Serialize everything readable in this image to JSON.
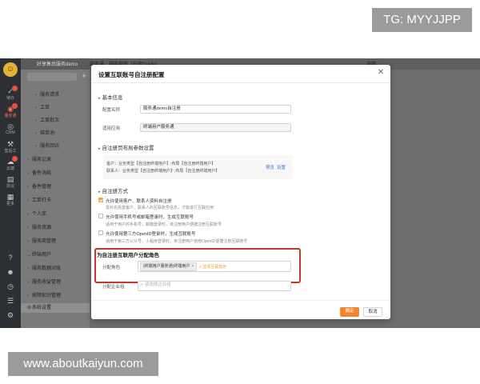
{
  "watermarks": {
    "top": "TG: MYYJJPP",
    "bottom": "www.aboutkaiyun.com"
  },
  "app": {
    "header_title": "好享售后服务demo",
    "tabs": [
      "服务通",
      "服务指南（升级Guide）"
    ],
    "right_label": "全部"
  },
  "rail": {
    "items": [
      {
        "label": "待办",
        "icon": "check-icon"
      },
      {
        "label": "服务通",
        "icon": "service-icon",
        "active": true
      },
      {
        "label": "CRM",
        "icon": "crm-icon"
      },
      {
        "label": "售后工",
        "icon": "wrench-icon"
      },
      {
        "label": "云端",
        "icon": "cloud-icon"
      },
      {
        "label": "协议",
        "icon": "doc-icon"
      },
      {
        "label": "更多",
        "icon": "grid-icon"
      }
    ]
  },
  "tree": {
    "items": [
      {
        "label": "服务请求",
        "sub": true
      },
      {
        "label": "工单",
        "sub": true
      },
      {
        "label": "工单批次",
        "sub": true
      },
      {
        "label": "结单池",
        "sub": true
      },
      {
        "label": "服务回访",
        "sub": true
      },
      {
        "label": "服务记录",
        "sub": false
      },
      {
        "label": "备件消耗",
        "sub": false
      },
      {
        "label": "备件管理",
        "sub": false
      },
      {
        "label": "工单打卡",
        "sub": false
      },
      {
        "label": "个人库",
        "sub": false
      },
      {
        "label": "服务资源",
        "sub": false
      },
      {
        "label": "服务商管理",
        "sub": false
      },
      {
        "label": "终端用户",
        "sub": false
      },
      {
        "label": "服务数据对账",
        "sub": false
      },
      {
        "label": "服务收益管理",
        "sub": false
      },
      {
        "label": "故障知识管理",
        "sub": false
      },
      {
        "label": "系统设置",
        "sub": false,
        "selected": true
      }
    ]
  },
  "dialog": {
    "title": "设置互联账号自注册配置",
    "basic": {
      "heading": "基本信息",
      "name_label": "配置名称",
      "name_value": "服务通demo自注册",
      "app_label": "适用应用",
      "app_value": "终端用户服务通"
    },
    "layout": {
      "heading": "自注册页布局参数设置",
      "line1": "客户：业务类型【自注册终端用户】;布局【自注册终端用户】",
      "line2": "联系人：业务类型【自注册终端用户】;布局【自注册终端用户】",
      "preview": "预览",
      "settings": "设置"
    },
    "method": {
      "heading": "自注册方式",
      "options": [
        {
          "label": "允许使用客户、联系人资料自注册",
          "desc": "需补充完善客户、联系人的互联账号信息，才能进行互联应用",
          "checked": true
        },
        {
          "label": "允许使用手机号或邮箱登录时，生成互联账号",
          "desc": "适用于用户的手机号，邮箱登录时，未注册用户便捷注册互联账号",
          "checked": false
        },
        {
          "label": "允许使用第三方OpenID登录时，生成互联账号",
          "desc": "适用于第三方公众号、小程序登录时，未注册用户使用OpenID便捷注册互联账号",
          "checked": false
        }
      ]
    },
    "role": {
      "heading": "为自注册互联用户分配角色",
      "label": "分配角色",
      "tag": "(终端用户服务通)终端用户",
      "add_link": "+ 选择互联角色"
    },
    "enterprise": {
      "label": "分配企业组",
      "placeholder": "+ 请选择企业组"
    },
    "buttons": {
      "ok": "确定",
      "cancel": "取消"
    }
  }
}
